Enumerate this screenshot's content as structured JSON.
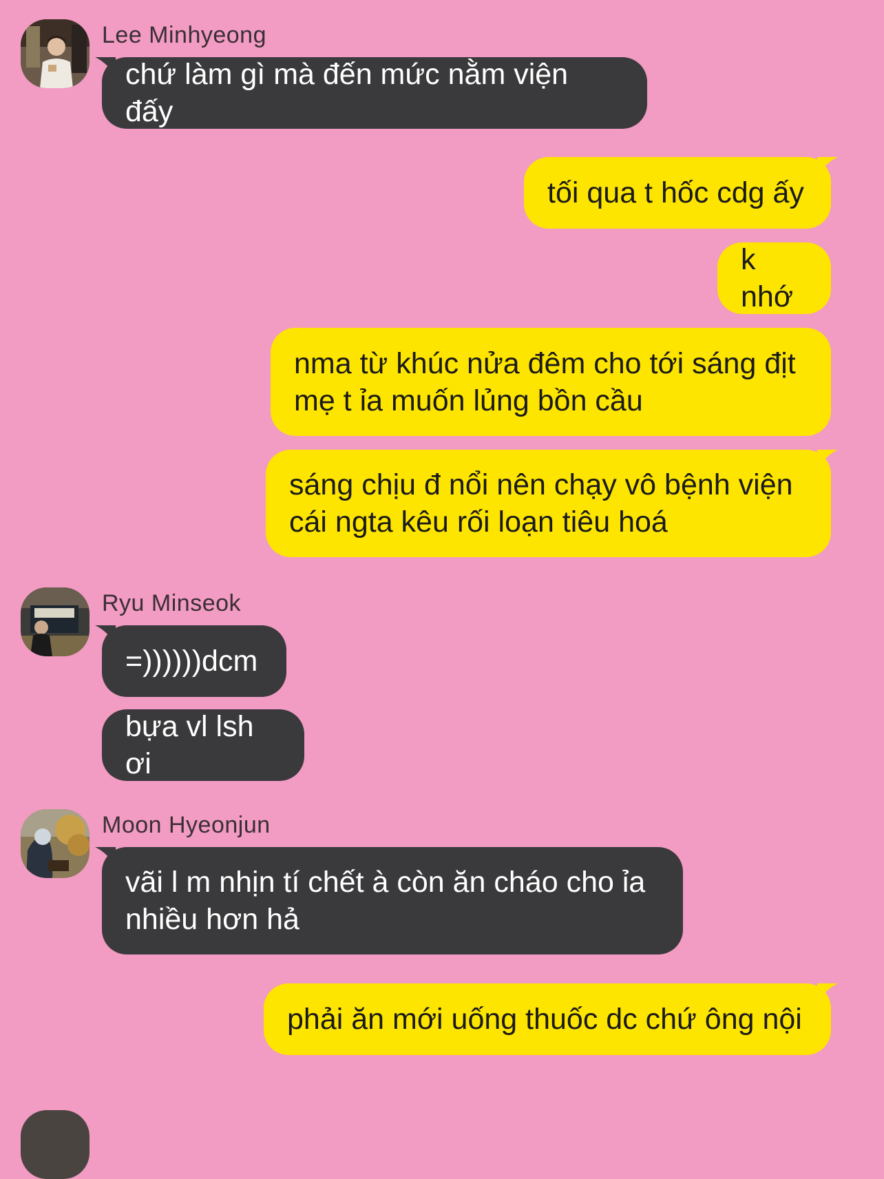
{
  "chat": {
    "background_color": "#f29bc3",
    "incoming_bubble_color": "#3a3a3c",
    "outgoing_bubble_color": "#fee500",
    "groups": [
      {
        "sender": "Lee Minhyeong",
        "avatar_icon": "profile-photo-icon",
        "messages": [
          "chứ làm gì mà đến mức nằm viện đấy"
        ]
      },
      {
        "sender": "",
        "outgoing": true,
        "messages": [
          "tối qua t hốc cdg ấy",
          "k nhớ",
          "nma từ khúc nửa đêm cho tới sáng địt mẹ t ỉa muốn lủng bồn cầu",
          "sáng chịu đ nổi nên chạy vô bệnh viện cái ngta kêu rối loạn tiêu hoá"
        ]
      },
      {
        "sender": "Ryu Minseok",
        "avatar_icon": "profile-photo-icon",
        "messages": [
          "=))))))dcm",
          "bựa vl lsh ơi"
        ]
      },
      {
        "sender": "Moon Hyeonjun",
        "avatar_icon": "profile-photo-icon",
        "messages": [
          "vãi l m nhịn tí chết à còn ăn cháo cho ỉa nhiều hơn hả"
        ]
      },
      {
        "sender": "",
        "outgoing": true,
        "messages": [
          "phải ăn mới uống thuốc dc chứ ông nội"
        ]
      }
    ]
  }
}
